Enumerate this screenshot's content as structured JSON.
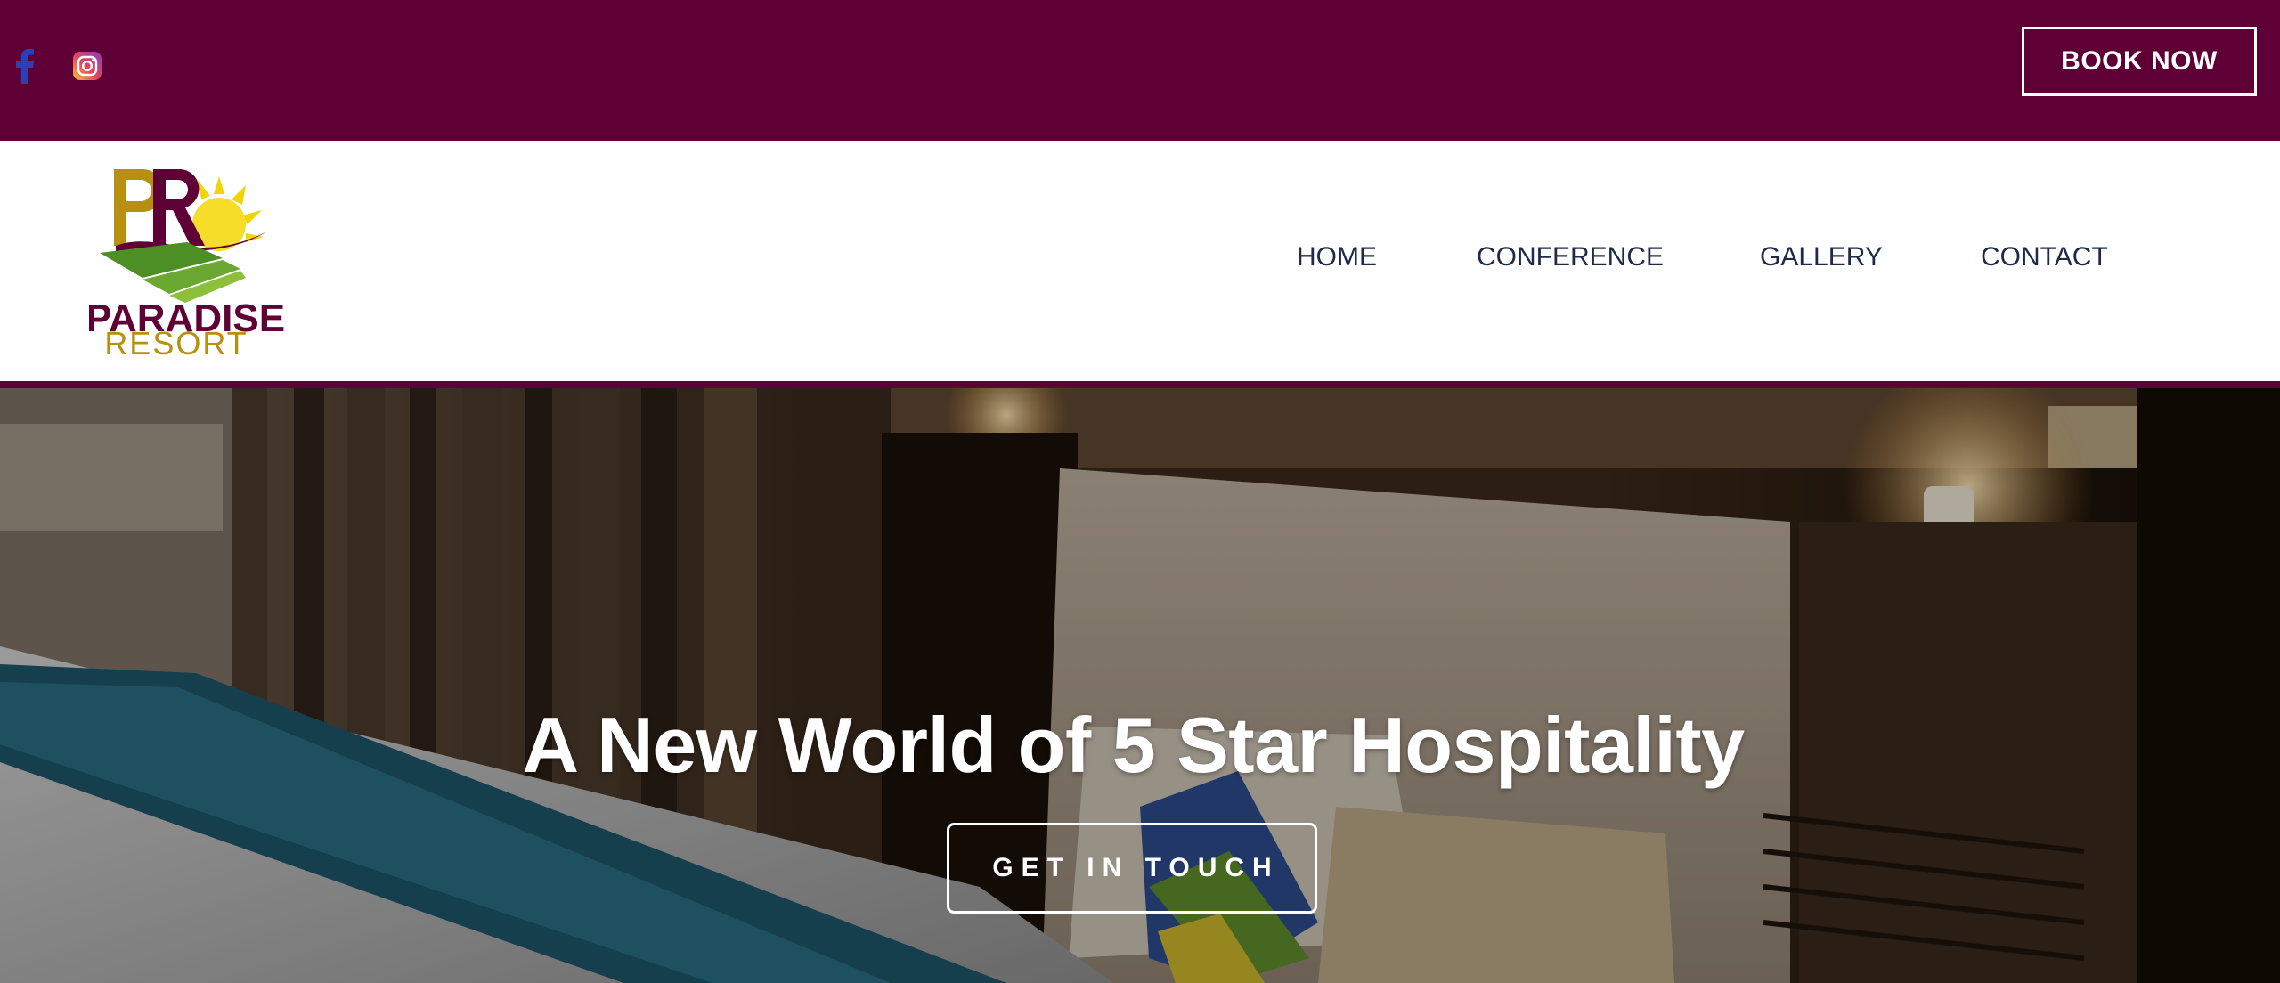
{
  "social": {
    "facebook_icon": "facebook-icon",
    "instagram_icon": "instagram-icon"
  },
  "topbar": {
    "book_now_label": "BOOK NOW"
  },
  "logo": {
    "monogram": "PR",
    "line1": "PARADISE",
    "line2": "RESORT"
  },
  "nav": {
    "items": [
      {
        "label": "HOME"
      },
      {
        "label": "CONFERENCE"
      },
      {
        "label": "GALLERY"
      },
      {
        "label": "CONTACT"
      }
    ]
  },
  "hero": {
    "title": "A New World of 5 Star Hospitality",
    "cta_label": "GET IN TOUCH"
  },
  "colors": {
    "brand_maroon": "#5e0035",
    "brand_gold": "#b8900f",
    "nav_text": "#1d2a4a",
    "facebook_blue": "#2b3fb8"
  }
}
